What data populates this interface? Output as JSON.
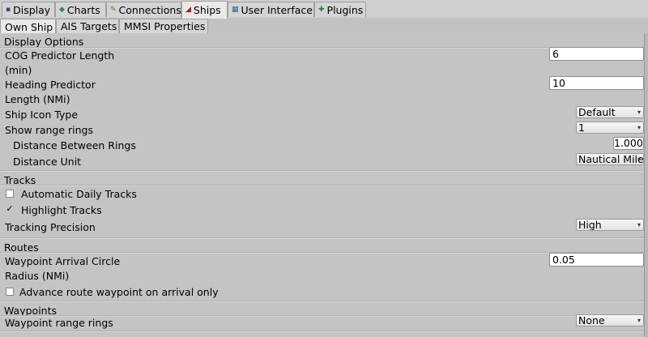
{
  "tabs": [
    {
      "label": "Display",
      "icon": "display-icon",
      "glyph": "▪",
      "color": "#2b4a7a"
    },
    {
      "label": "Charts",
      "icon": "charts-icon",
      "glyph": "◆",
      "color": "#3a7a8a"
    },
    {
      "label": "Connections",
      "icon": "connections-icon",
      "glyph": "✎",
      "color": "#3a8a3a"
    },
    {
      "label": "Ships",
      "icon": "ships-icon",
      "glyph": "◢",
      "color": "#a01818"
    },
    {
      "label": "User Interface",
      "icon": "user-interface-icon",
      "glyph": "▦",
      "color": "#2a6a8a"
    },
    {
      "label": "Plugins",
      "icon": "plugins-icon",
      "glyph": "✚",
      "color": "#2a7a2a"
    }
  ],
  "subtabs": [
    "Own Ship",
    "AIS Targets",
    "MMSI Properties"
  ],
  "display_options": {
    "header": "Display Options",
    "cog_label_1": "COG Predictor Length",
    "cog_label_2": "(min)",
    "cog_value": "6",
    "heading_label_1": "Heading Predictor",
    "heading_label_2": "Length (NMi)",
    "heading_value": "10",
    "icon_type_label": "Ship Icon Type",
    "icon_type_value": "Default",
    "range_rings_label": "Show range rings",
    "range_rings_value": "1",
    "distance_label": "Distance Between Rings",
    "distance_value": "1.000",
    "unit_label": "Distance Unit",
    "unit_value": "Nautical Mile"
  },
  "tracks": {
    "header": "Tracks",
    "auto_daily_label": "Automatic Daily Tracks",
    "auto_daily_checked": false,
    "highlight_label": "Highlight Tracks",
    "highlight_checked": true,
    "precision_label": "Tracking Precision",
    "precision_value": "High"
  },
  "routes": {
    "header": "Routes",
    "arrival_label_1": "Waypoint Arrival Circle",
    "arrival_label_2": "Radius (NMi)",
    "arrival_value": "0.05",
    "advance_label": "Advance route waypoint on arrival only",
    "advance_checked": false
  },
  "waypoints": {
    "header": "Waypoints",
    "range_rings_label": "Waypoint range rings",
    "range_rings_value": "None"
  },
  "glyphs": {
    "check": "✓",
    "dropdown": "▾"
  }
}
